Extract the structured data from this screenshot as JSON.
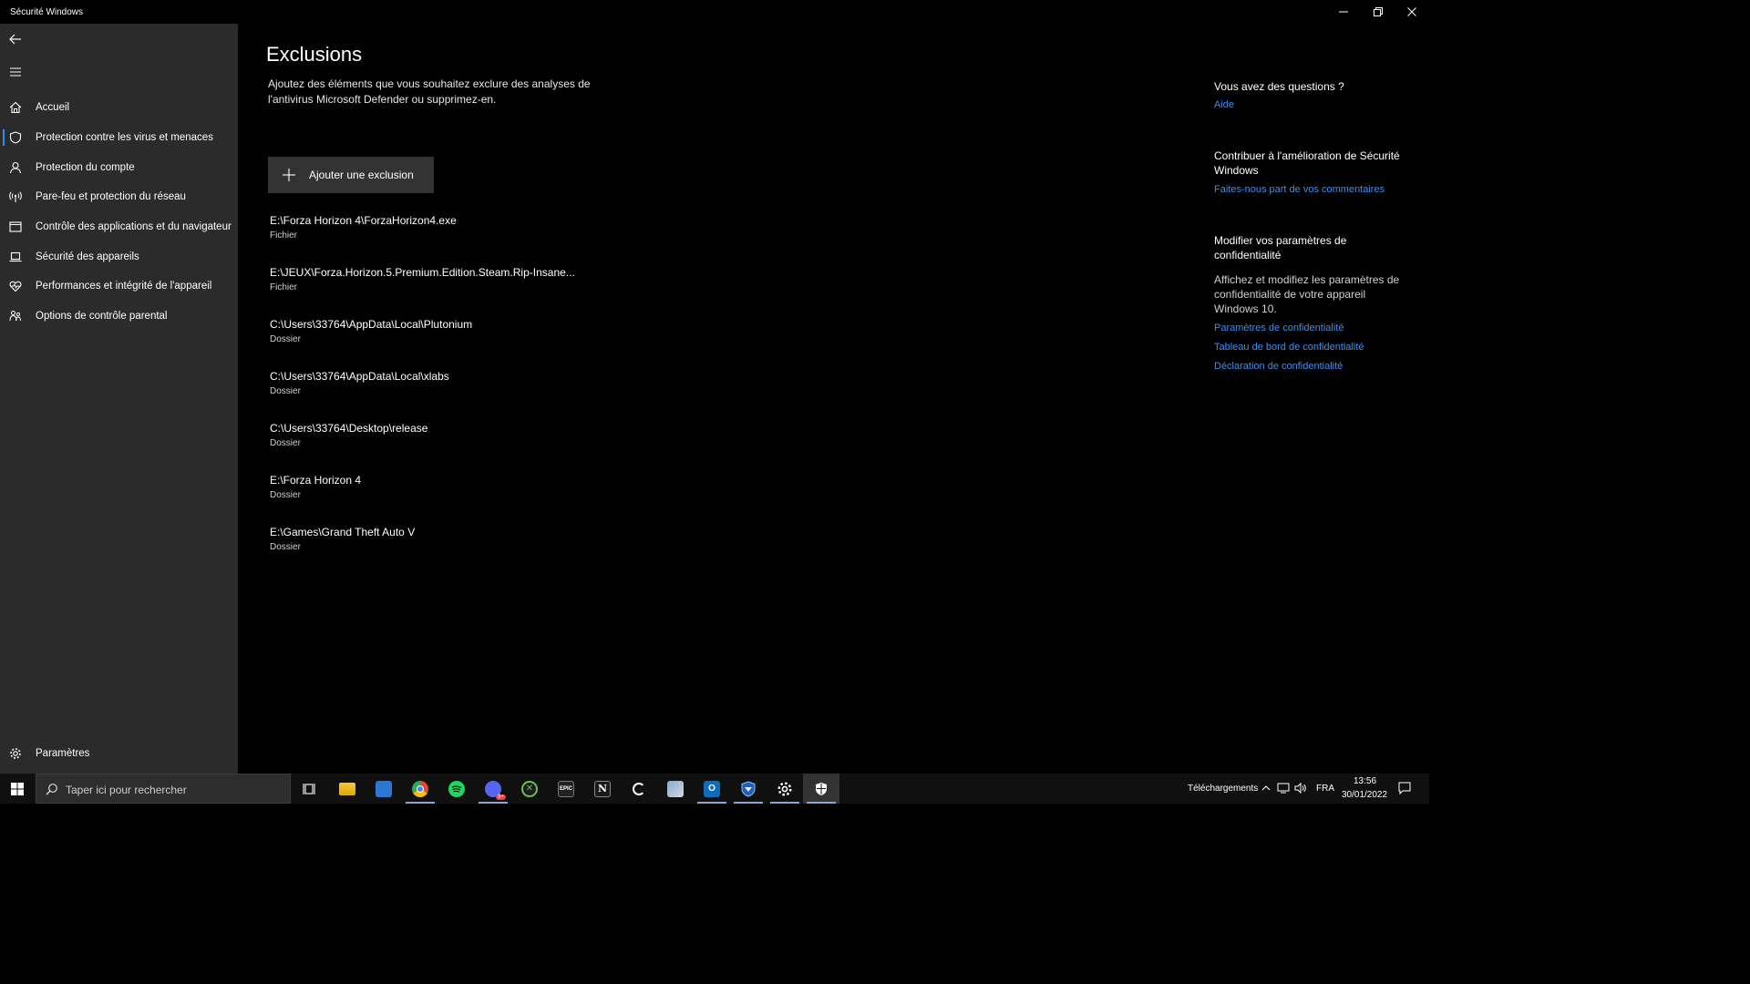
{
  "window": {
    "title": "Sécurité Windows"
  },
  "sidebar": {
    "items": [
      {
        "label": "Accueil",
        "icon": "home-icon"
      },
      {
        "label": "Protection contre les virus et menaces",
        "icon": "shield-icon",
        "active": true
      },
      {
        "label": "Protection du compte",
        "icon": "person-icon"
      },
      {
        "label": "Pare-feu et protection du réseau",
        "icon": "antenna-icon"
      },
      {
        "label": "Contrôle des applications et du navigateur",
        "icon": "app-window-icon"
      },
      {
        "label": "Sécurité des appareils",
        "icon": "laptop-icon"
      },
      {
        "label": "Performances et intégrité de l'appareil",
        "icon": "heart-icon"
      },
      {
        "label": "Options de contrôle parental",
        "icon": "family-icon"
      }
    ],
    "settings_label": "Paramètres"
  },
  "main": {
    "title": "Exclusions",
    "description": "Ajoutez des éléments que vous souhaitez exclure des analyses de l'antivirus Microsoft Defender ou supprimez-en.",
    "add_button_label": "Ajouter une exclusion",
    "exclusions": [
      {
        "path": "E:\\Forza Horizon 4\\ForzaHorizon4.exe",
        "type": "Fichier"
      },
      {
        "path": "E:\\JEUX\\Forza.Horizon.5.Premium.Edition.Steam.Rip-Insane...",
        "type": "Fichier"
      },
      {
        "path": "C:\\Users\\33764\\AppData\\Local\\Plutonium",
        "type": "Dossier"
      },
      {
        "path": "C:\\Users\\33764\\AppData\\Local\\xlabs",
        "type": "Dossier"
      },
      {
        "path": "C:\\Users\\33764\\Desktop\\release",
        "type": "Dossier"
      },
      {
        "path": "E:\\Forza Horizon 4",
        "type": "Dossier"
      },
      {
        "path": "E:\\Games\\Grand Theft Auto V",
        "type": "Dossier"
      }
    ]
  },
  "right": {
    "questions_heading": "Vous avez des questions ?",
    "help_link": "Aide",
    "contribute_heading": "Contribuer à l'amélioration de Sécurité Windows",
    "feedback_link": "Faites-nous part de vos commentaires",
    "privacy_heading": "Modifier vos paramètres de confidentialité",
    "privacy_text": "Affichez et modifiez les paramètres de confidentialité de votre appareil Windows 10.",
    "privacy_links": [
      "Paramètres de confidentialité",
      "Tableau de bord de confidentialité",
      "Déclaration de confidentialité"
    ]
  },
  "taskbar": {
    "search_placeholder": "Taper ici pour rechercher",
    "apps": [
      "task-view-icon",
      "file-explorer-icon",
      "store-icon",
      "chrome-icon",
      "spotify-icon",
      "discord-icon",
      "xbox-icon",
      "epic-games-icon",
      "notion-icon",
      "logitech-icon",
      "photos-icon",
      "outlook-icon",
      "rocket-league-icon",
      "settings-icon",
      "windows-security-icon"
    ],
    "epic_label": "EPIC",
    "discord_badge": "9+",
    "downloads_label": "Téléchargements",
    "language": "FRA",
    "time": "13:56",
    "date": "30/01/2022"
  },
  "colors": {
    "accent": "#2f8cf5",
    "link": "#3a8ff0",
    "sidebar_bg": "#2b2b2b",
    "main_bg": "#000000"
  }
}
